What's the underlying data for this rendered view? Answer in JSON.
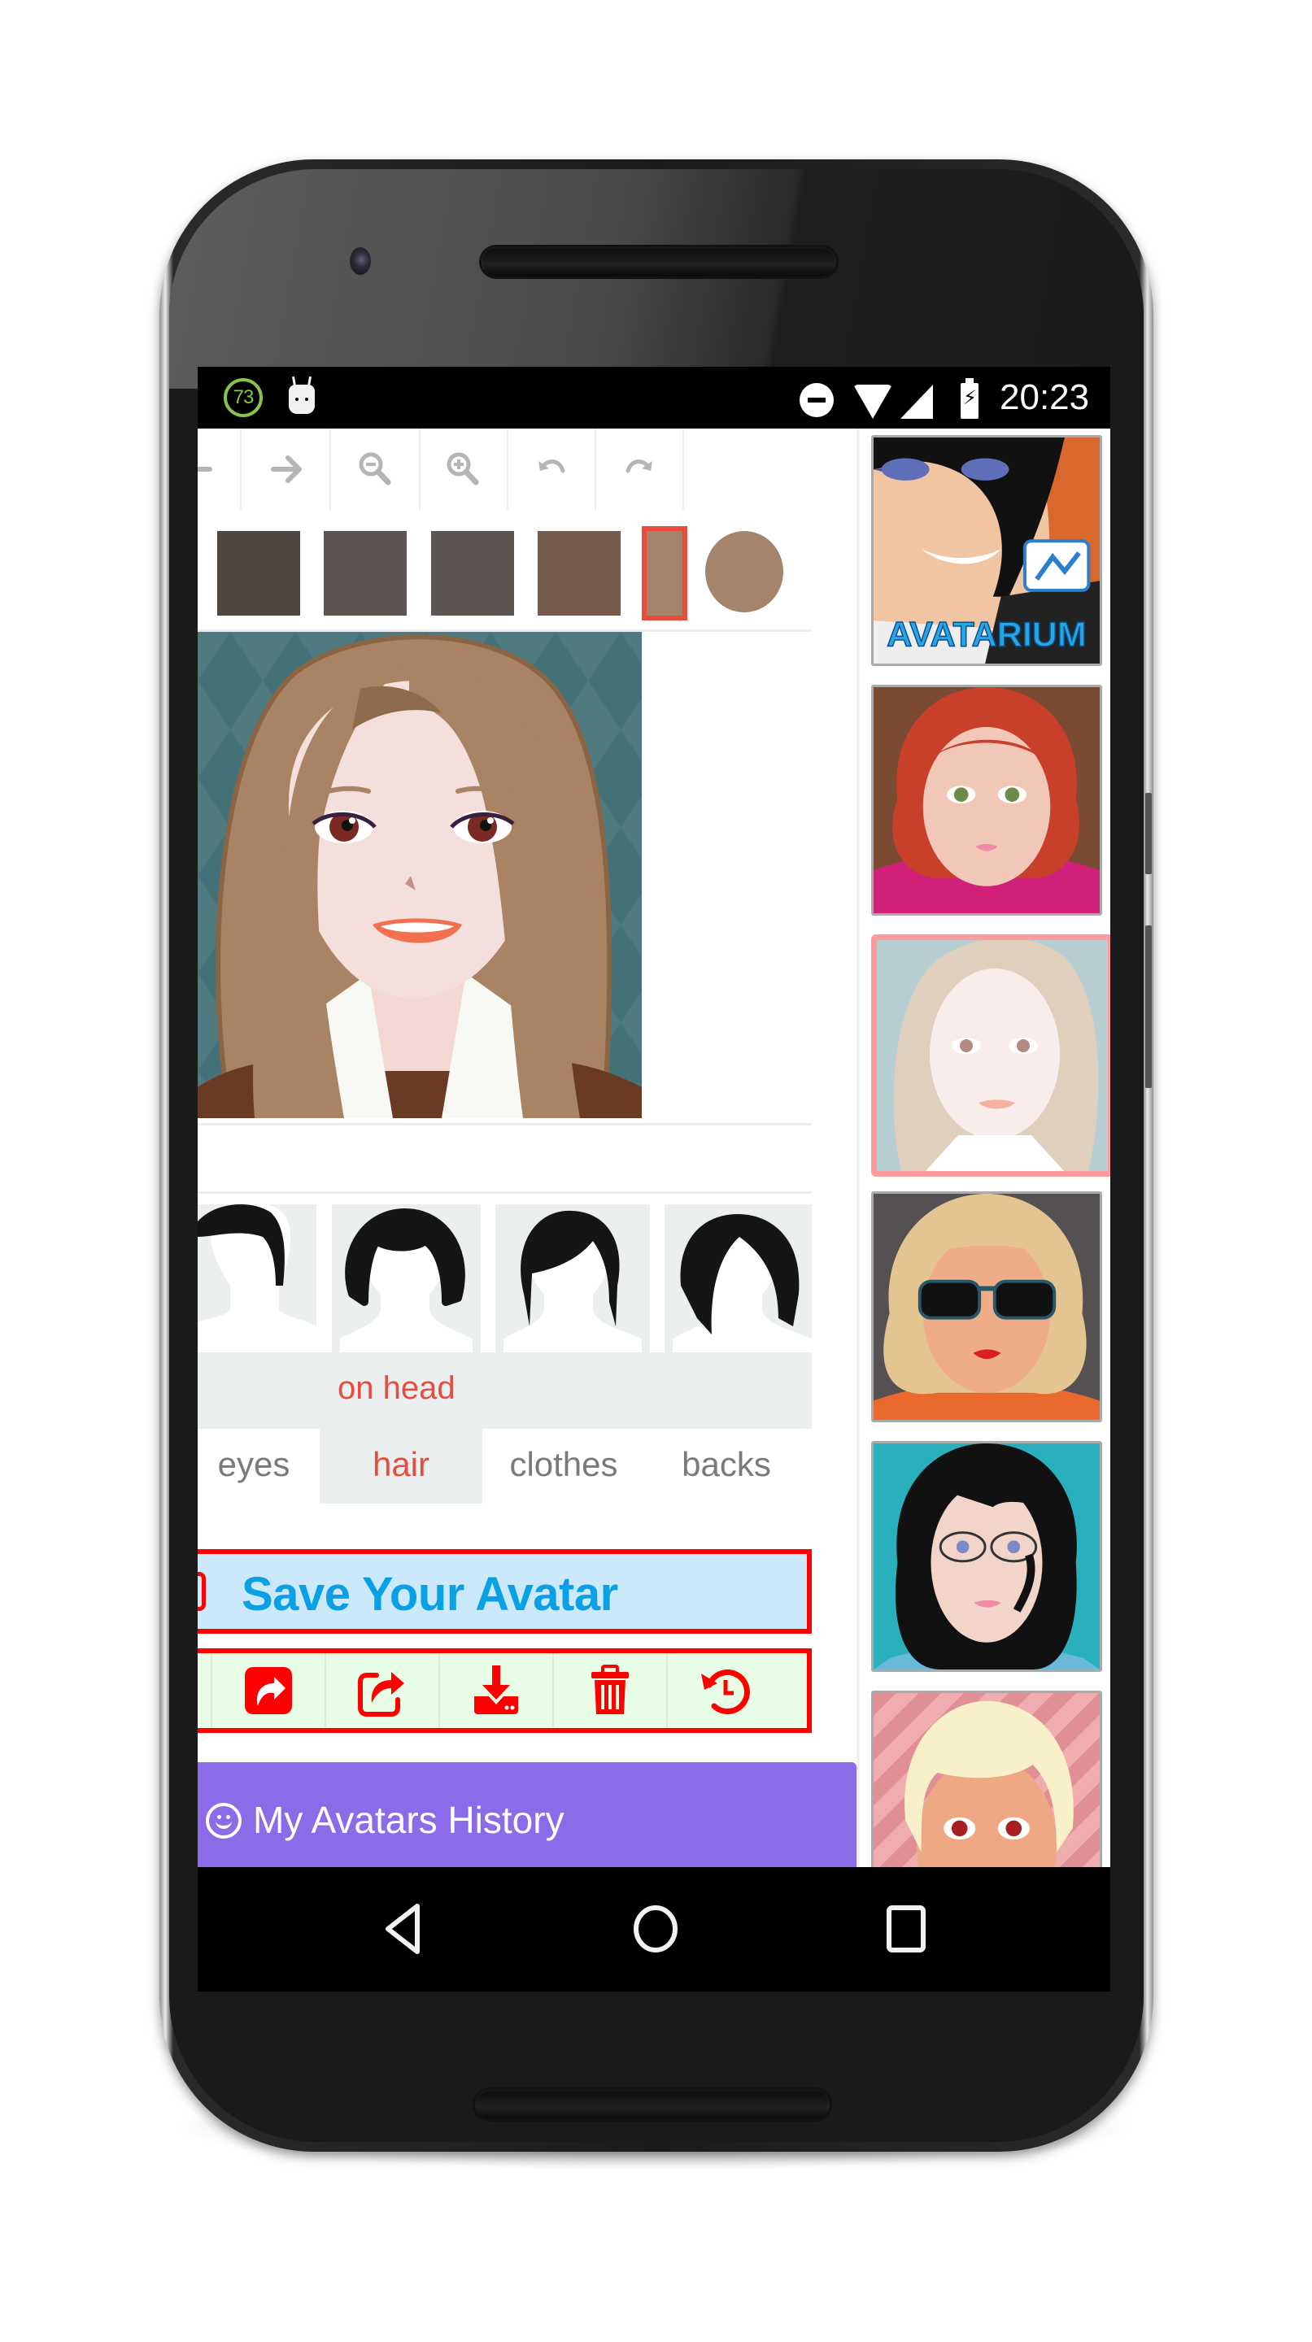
{
  "status_bar": {
    "notification_badge": "73",
    "time": "20:23",
    "icons": [
      "badge-73-icon",
      "android-robot-icon",
      "do-not-disturb-icon",
      "wifi-icon",
      "signal-icon",
      "battery-charging-icon"
    ]
  },
  "toolbar": {
    "items": [
      {
        "name": "back-arrow",
        "icon": "arrow-left-icon"
      },
      {
        "name": "forward-arrow",
        "icon": "arrow-right-icon"
      },
      {
        "name": "zoom-out",
        "icon": "zoom-out-icon"
      },
      {
        "name": "zoom-in",
        "icon": "zoom-in-icon"
      },
      {
        "name": "undo",
        "icon": "undo-icon"
      },
      {
        "name": "redo",
        "icon": "redo-icon"
      }
    ]
  },
  "colors": {
    "swatches": [
      "#504740",
      "#5e5452",
      "#5e5452",
      "#775c4d",
      "#a4846a"
    ],
    "selected_swatch_index": 4,
    "current_color": "#a4846a",
    "accent_red": "#e84c3d",
    "save_text_blue": "#0aa0e6",
    "history_purple": "#8a6be8"
  },
  "editor": {
    "subcategory": "on head",
    "tabs": [
      {
        "label": "eyes",
        "active": false
      },
      {
        "label": "hair",
        "active": true
      },
      {
        "label": "clothes",
        "active": false
      },
      {
        "label": "backs",
        "active": false
      }
    ],
    "hair_options": [
      "short-hair",
      "curly-hair",
      "side-swept-hair",
      "bob-hair"
    ]
  },
  "save": {
    "label": "Save Your Avatar"
  },
  "actions": [
    {
      "name": "share",
      "icon": "share-square-icon"
    },
    {
      "name": "export",
      "icon": "external-share-icon"
    },
    {
      "name": "download",
      "icon": "download-icon"
    },
    {
      "name": "delete",
      "icon": "trash-icon"
    },
    {
      "name": "history-reset",
      "icon": "history-icon"
    }
  ],
  "history": {
    "label": "My Avatars History",
    "icon": "smiley-icon"
  },
  "gallery": {
    "items": [
      {
        "name": "avatarium-promo",
        "caption": "AVATARIUM",
        "selected": false
      },
      {
        "name": "red-hair-avatar",
        "selected": false
      },
      {
        "name": "current-avatar",
        "selected": true
      },
      {
        "name": "sunglasses-avatar",
        "selected": false
      },
      {
        "name": "glasses-avatar",
        "selected": false
      },
      {
        "name": "blonde-avatar",
        "selected": false
      }
    ]
  },
  "navbar": {
    "buttons": [
      "back-icon",
      "home-icon",
      "recents-icon"
    ]
  }
}
